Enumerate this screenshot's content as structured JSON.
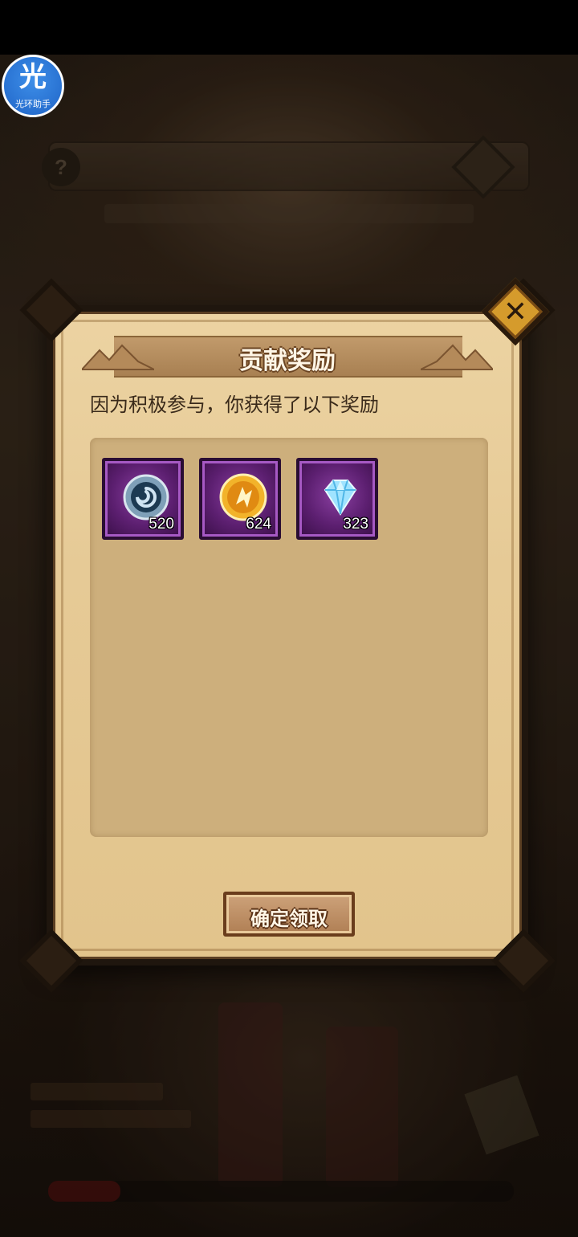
{
  "assistant_badge": {
    "glyph": "光",
    "label": "光环助手"
  },
  "dialog": {
    "title": "贡献奖励",
    "description": "因为积极参与，你获得了以下奖励",
    "confirm_label": "确定领取"
  },
  "rewards": [
    {
      "icon": "swirl-orb-icon",
      "count": "520"
    },
    {
      "icon": "golden-emblem-icon",
      "count": "624"
    },
    {
      "icon": "diamond-icon",
      "count": "323"
    }
  ],
  "colors": {
    "parchment": "#e6ca96",
    "item_frame": "#5c1f70",
    "close_button": "#d59b2c",
    "assistant_blue": "#2a78d8"
  }
}
